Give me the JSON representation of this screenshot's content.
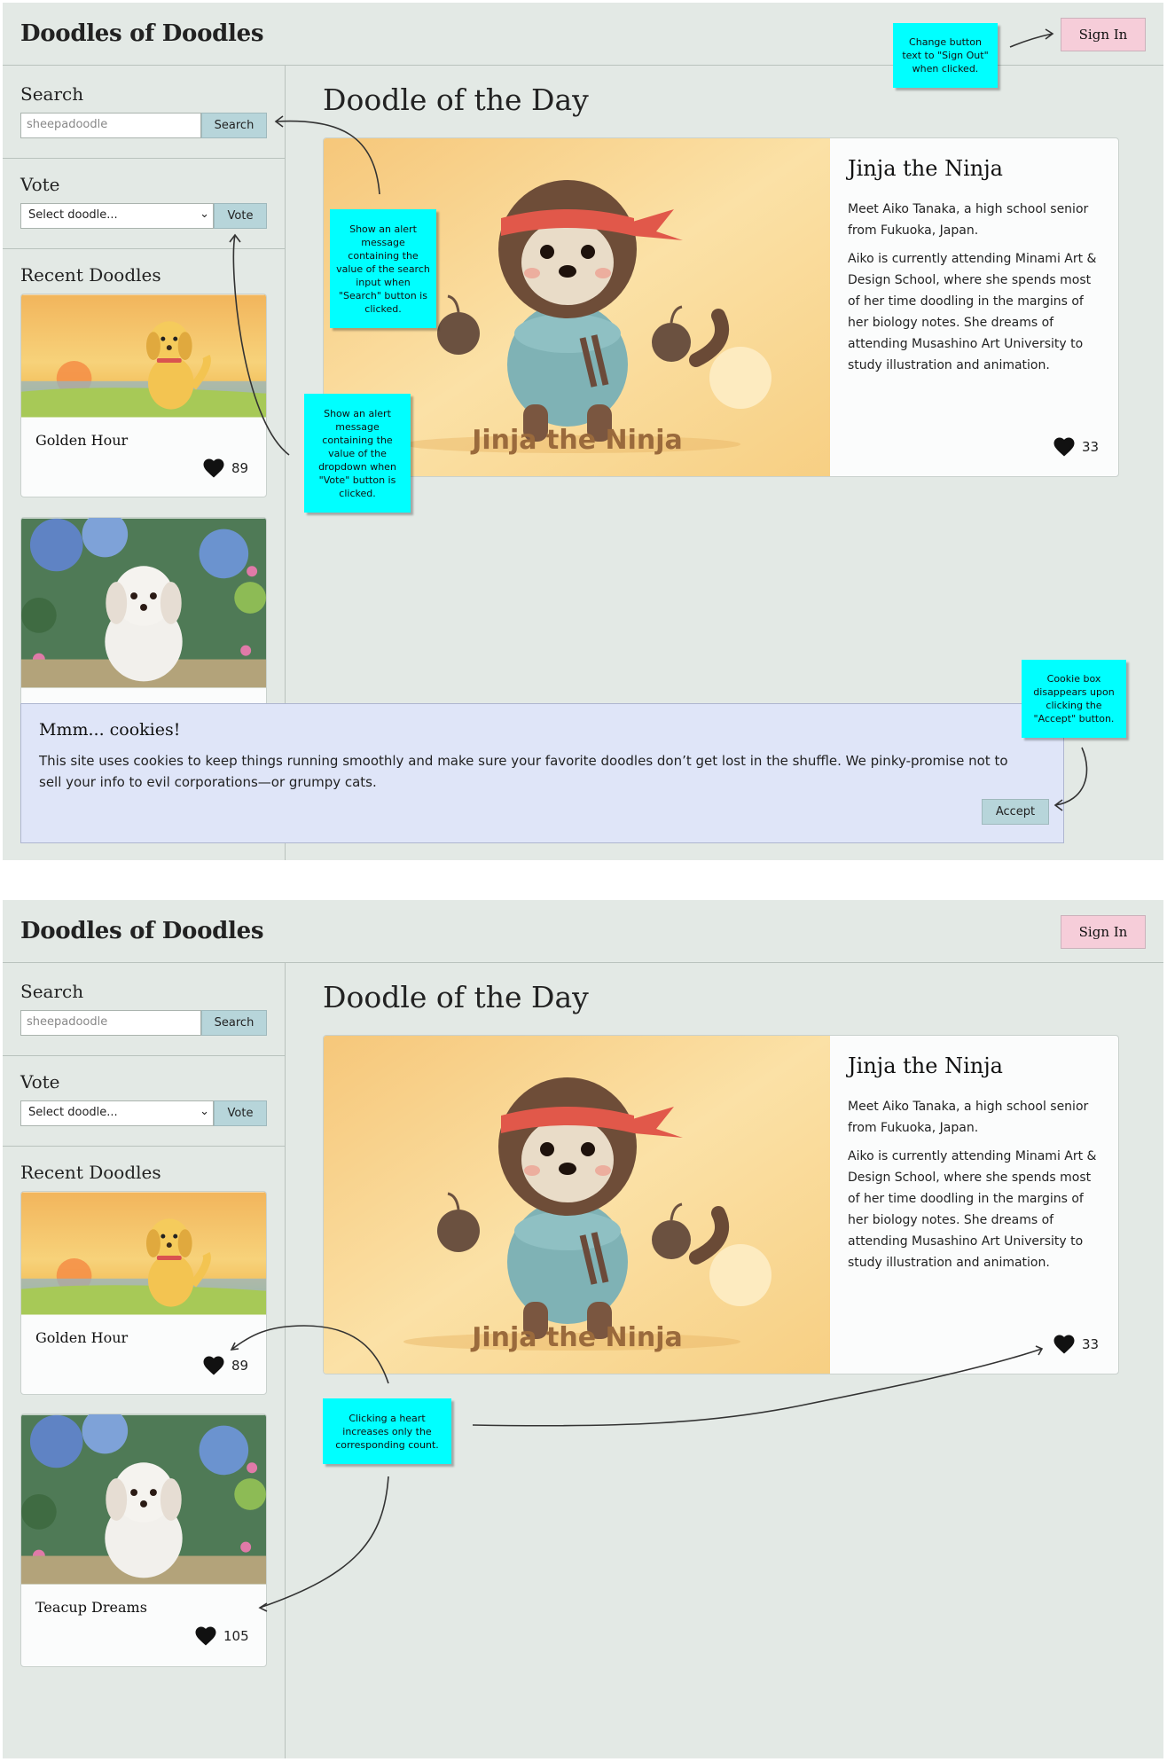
{
  "site": {
    "title": "Doodles of Doodles",
    "signin_label": "Sign In"
  },
  "sidebar": {
    "search": {
      "heading": "Search",
      "placeholder": "sheepadoodle",
      "button": "Search"
    },
    "vote": {
      "heading": "Vote",
      "select_value": "Select doodle...",
      "button": "Vote"
    },
    "recent_heading": "Recent Doodles",
    "cards": [
      {
        "name": "Golden Hour",
        "likes": "89"
      },
      {
        "name": "Teacup Dreams",
        "likes": "105"
      }
    ]
  },
  "main": {
    "heading": "Doodle of the Day",
    "doodle": {
      "name": "Jinja the Ninja",
      "image_caption": "Jinja the Ninja",
      "para1": "Meet Aiko Tanaka, a high school senior from Fukuoka, Japan.",
      "para2": "Aiko is currently attending Minami Art & Design School, where she spends most of her time doodling in the margins of her biology notes. She dreams of attending Musashino Art University to study illustration and animation.",
      "likes": "33"
    }
  },
  "cookie": {
    "heading": "Mmm... cookies!",
    "text": "This site uses cookies to keep things running smoothly and make sure your favorite doodles don’t get lost in the shuffle. We pinky-promise not to sell your info to evil corporations—or grumpy cats.",
    "accept": "Accept"
  },
  "annotations": {
    "signout": "Change button text to \"Sign Out\" when clicked.",
    "search_alert": "Show an alert message containing the value of the search input when \"Search\" button is clicked.",
    "vote_alert": "Show an alert message containing the value of the dropdown when \"Vote\" button is clicked.",
    "cookie_accept": "Cookie box disappears upon clicking the \"Accept\" button.",
    "heart": "Clicking a heart increases only the corresponding count."
  },
  "colors": {
    "background": "#e3e9e5",
    "signin": "#f6cdd9",
    "small_button": "#b7d5da",
    "cookie_box": "#dfe5f8",
    "sticky_note": "#00ffff"
  },
  "icons": [
    "heart-icon",
    "chevron-down-icon"
  ]
}
